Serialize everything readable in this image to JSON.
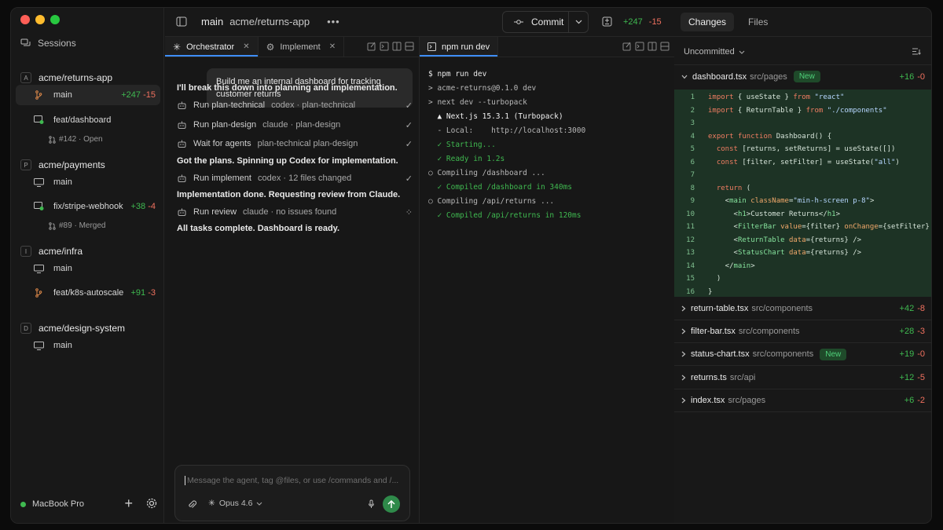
{
  "sidebar": {
    "sessions_label": "Sessions",
    "projects": [
      {
        "letter": "A",
        "name": "acme/returns-app",
        "branches": [
          {
            "name": "main",
            "add": "+247",
            "del": "-15",
            "active": true,
            "icon": "branch-icon"
          },
          {
            "name": "feat/dashboard",
            "sub": "#142 · Open",
            "icon": "pr-icon"
          }
        ]
      },
      {
        "letter": "P",
        "name": "acme/payments",
        "branches": [
          {
            "name": "main",
            "icon": "monitor-icon"
          },
          {
            "name": "fix/stripe-webhook",
            "add": "+38",
            "del": "-4",
            "sub": "#89 · Merged",
            "icon": "pr-icon"
          }
        ]
      },
      {
        "letter": "I",
        "name": "acme/infra",
        "branches": [
          {
            "name": "main",
            "icon": "monitor-icon"
          },
          {
            "name": "feat/k8s-autoscale",
            "add": "+91",
            "del": "-3",
            "icon": "branch-icon"
          }
        ]
      },
      {
        "letter": "D",
        "name": "acme/design-system",
        "branches": [
          {
            "name": "main",
            "icon": "monitor-icon"
          }
        ]
      }
    ],
    "footer": {
      "machine": "MacBook Pro"
    }
  },
  "topbar": {
    "branch": "main",
    "repo": "acme/returns-app",
    "commit_label": "Commit",
    "add": "+247",
    "del": "-15"
  },
  "chat": {
    "tabs": [
      {
        "label": "Orchestrator",
        "active": true
      },
      {
        "label": "Implement"
      }
    ],
    "user_message": "Build me an internal dashboard for tracking customer returns",
    "items": [
      {
        "kind": "msg",
        "text": "I'll break this down into planning and implementation."
      },
      {
        "kind": "step",
        "title": "Run plan-technical",
        "detail": "codex · plan-technical",
        "status": "done"
      },
      {
        "kind": "step",
        "title": "Run plan-design",
        "detail": "claude · plan-design",
        "status": "done"
      },
      {
        "kind": "step",
        "title": "Wait for agents",
        "detail": "plan-technical plan-design",
        "status": "done"
      },
      {
        "kind": "msg",
        "text": "Got the plans. Spinning up Codex for implementation."
      },
      {
        "kind": "step",
        "title": "Run implement",
        "detail": "codex · 12 files changed",
        "status": "done"
      },
      {
        "kind": "msg",
        "text": "Implementation done. Requesting review from Claude."
      },
      {
        "kind": "step",
        "title": "Run review",
        "detail": "claude · no issues found",
        "status": "running"
      },
      {
        "kind": "msg",
        "text": "All tasks complete. Dashboard is ready."
      }
    ],
    "composer": {
      "placeholder": "Message the agent, tag @files, or use /commands and /...",
      "model": "Opus 4.6"
    }
  },
  "terminal": {
    "tab_label": "npm run dev",
    "lines": [
      {
        "text": "$ npm run dev",
        "style": "cmd"
      },
      {
        "text": "> acme-returns@0.1.0 dev",
        "style": "dim"
      },
      {
        "text": "> next dev --turbopack",
        "style": "dim"
      },
      {
        "text": "  ▲ Next.js 15.3.1 (Turbopack)",
        "style": "bold"
      },
      {
        "text": "  - Local:    http://localhost:3000",
        "style": "dim"
      },
      {
        "text": "  ✓ Starting...",
        "style": "ok"
      },
      {
        "text": "  ✓ Ready in 1.2s",
        "style": "ok"
      },
      {
        "text": "○ Compiling /dashboard ...",
        "style": "dim"
      },
      {
        "text": "  ✓ Compiled /dashboard in 340ms",
        "style": "ok"
      },
      {
        "text": "○ Compiling /api/returns ...",
        "style": "dim"
      },
      {
        "text": "  ✓ Compiled /api/returns in 120ms",
        "style": "ok"
      }
    ]
  },
  "changes": {
    "tabs": [
      {
        "label": "Changes",
        "active": true
      },
      {
        "label": "Files"
      }
    ],
    "filter": "Uncommitted",
    "files": [
      {
        "name": "dashboard.tsx",
        "path": "src/pages",
        "badge": "New",
        "add": "+16",
        "del": "-0",
        "expanded": true
      },
      {
        "name": "return-table.tsx",
        "path": "src/components",
        "add": "+42",
        "del": "-8"
      },
      {
        "name": "filter-bar.tsx",
        "path": "src/components",
        "add": "+28",
        "del": "-3"
      },
      {
        "name": "status-chart.tsx",
        "path": "src/components",
        "badge": "New",
        "add": "+19",
        "del": "-0"
      },
      {
        "name": "returns.ts",
        "path": "src/api",
        "add": "+12",
        "del": "-5"
      },
      {
        "name": "index.tsx",
        "path": "src/pages",
        "add": "+6",
        "del": "-2"
      }
    ],
    "code_lines": [
      "import { useState } from \"react\"",
      "import { ReturnTable } from \"./components\"",
      "",
      "export function Dashboard() {",
      "  const [returns, setReturns] = useState([])",
      "  const [filter, setFilter] = useState(\"all\")",
      "",
      "  return (",
      "    <main className=\"min-h-screen p-8\">",
      "      <h1>Customer Returns</h1>",
      "      <FilterBar value={filter} onChange={setFilter} />",
      "      <ReturnTable data={returns} />",
      "      <StatusChart data={returns} />",
      "    </main>",
      "  )",
      "}"
    ]
  },
  "colors": {
    "accent": "#3e8ef7",
    "add": "#3fb950",
    "del": "#f0715f",
    "diff_bg": "#1d3325"
  }
}
